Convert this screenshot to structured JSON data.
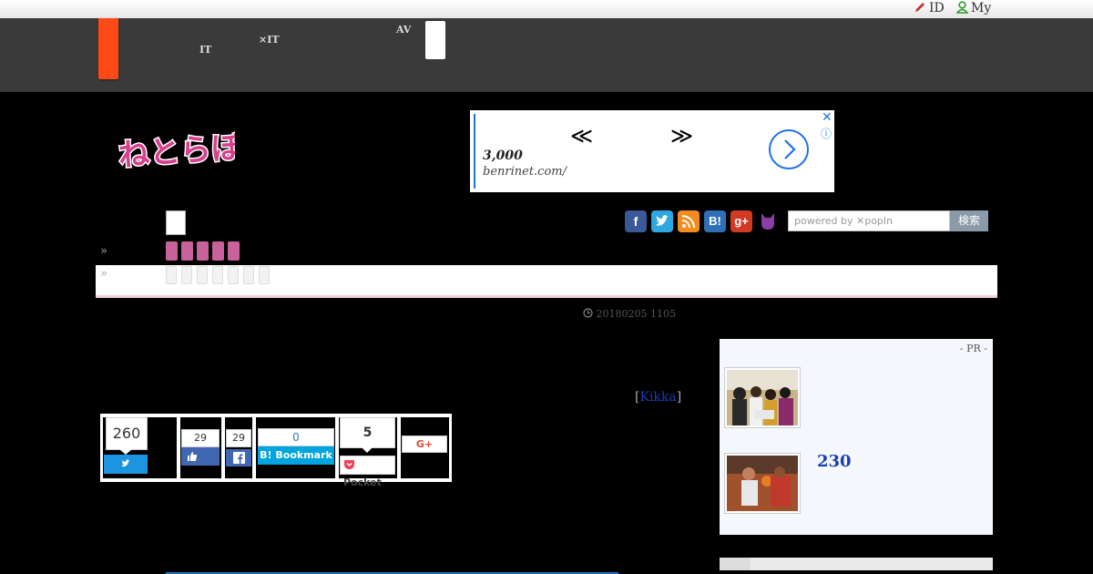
{
  "util_bar": {
    "id_label": "ID",
    "my_label": "My"
  },
  "global_nav": {
    "items": [
      "",
      "IT",
      "",
      "×IT",
      "AV",
      ""
    ],
    "item_col1_top": "",
    "item_col1_bottom": "IT",
    "item_col2_top": "",
    "item_col2_bottom": "×IT",
    "item_col3_top": "AV",
    "item_col3_bottom": ""
  },
  "header": {
    "logo_text": "ねとらぼ",
    "ad": {
      "prev_arrow": "≪",
      "next_arrow": "≫",
      "price": "3,000",
      "url": "benrinet.com/",
      "close_icon": "close-icon",
      "info_icon": "info-icon"
    }
  },
  "social": {
    "icons": [
      "facebook-icon",
      "twitter-icon",
      "rss-icon",
      "hatena-icon",
      "google-plus-icon",
      "cat-icon"
    ],
    "hatena_label": "B!",
    "gplus_label": "g+"
  },
  "search": {
    "placeholder": "powered by ✕popIn",
    "button_label": "検索"
  },
  "breadcrumb": {
    "chevron1": "»",
    "chevron2": "»"
  },
  "article": {
    "date": "20180205 1105",
    "author_open": "[",
    "author_name": "Kikka",
    "author_close": "]"
  },
  "share": {
    "twitter_count": "260",
    "facebook_like_count": "29",
    "facebook_share_count": "29",
    "hatena_count": "0",
    "hatena_label": "Bookmark",
    "pocket_count": "5",
    "pocket_label": "Pocket",
    "gplus_label": "G+"
  },
  "sidebar": {
    "pr_label": "- PR -",
    "ranking_number": "230"
  },
  "colors": {
    "nav_bg": "#3a3a3a",
    "accent_orange": "#ff4a17",
    "pink": "#c9619a",
    "link_blue": "#1a3fb0",
    "twitter": "#1b95e0",
    "facebook": "#3b5998",
    "hatena": "#00a4de",
    "pocket": "#ee4056"
  }
}
